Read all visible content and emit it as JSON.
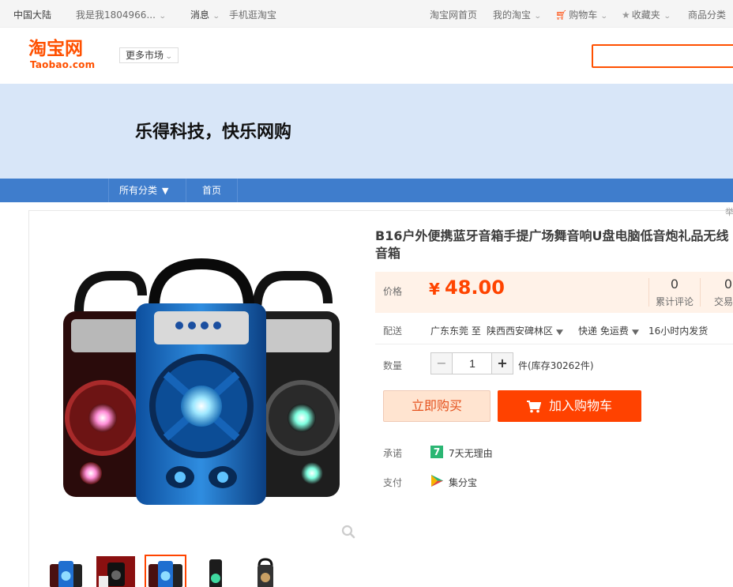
{
  "sitenav": {
    "region": "中国大陆",
    "user": "我是我1804966...",
    "messages": "消息",
    "mobile": "手机逛淘宝",
    "home": "淘宝网首页",
    "my_taobao": "我的淘宝",
    "cart": "购物车",
    "favorites": "收藏夹",
    "categories": "商品分类"
  },
  "header": {
    "logo_cn": "淘宝网",
    "logo_en": "Taobao.com",
    "more_market": "更多市场",
    "search": {
      "value": "",
      "placeholder": ""
    }
  },
  "banner": {
    "shop_slogan": "乐得科技，快乐网购"
  },
  "shopnav": {
    "all_categories": "所有分类",
    "home": "首页"
  },
  "side_tag": "举",
  "product": {
    "title": "B16户外便携蓝牙音箱手提广场舞音响U盘电脑低音炮礼品无线音箱",
    "price_label": "价格",
    "currency": "¥",
    "price": "48.00",
    "reviews_count": "0",
    "reviews_label": "累计评论",
    "trades_count": "0",
    "trades_label": "交易成",
    "shipping_label": "配送",
    "shipping_from": "广东东莞 至",
    "shipping_to": "陕西西安碑林区",
    "shipping_method": "快递 免运费",
    "dispatch": "16小时内发货",
    "quantity_label": "数量",
    "quantity": "1",
    "stock": "件(库存30262件)",
    "buy_now": "立即购买",
    "add_to_cart": "加入购物车",
    "promise_label": "承诺",
    "promise_badge": "7",
    "promise": "7天无理由",
    "payment_label": "支付",
    "payment": "集分宝"
  },
  "colors": {
    "brand": "#ff5000",
    "price": "#ff4400",
    "shop_nav": "#3f7dcc",
    "banner_bg": "#d8e6f8"
  }
}
